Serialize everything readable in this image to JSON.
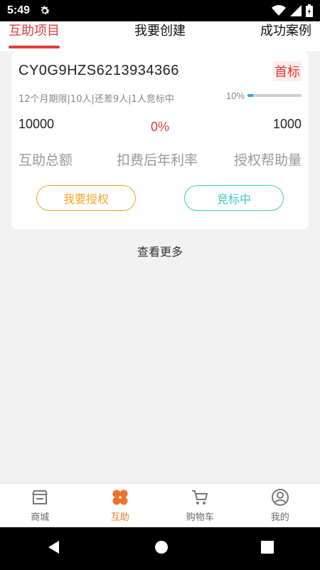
{
  "status": {
    "time": "5:49"
  },
  "tabs": [
    {
      "label": "互助项目",
      "active": true
    },
    {
      "label": "我要创建",
      "active": false
    },
    {
      "label": "成功案例",
      "active": false
    }
  ],
  "project": {
    "code": "CY0G9HZS6213934366",
    "badge": "首标",
    "meta": "12个月期限|10人|还差9人|1人竞标中",
    "progress_label": "10%",
    "progress_value": 0.1,
    "total_value": "10000",
    "rate_value": "0%",
    "auth_value": "1000",
    "total_label": "互助总额",
    "rate_label": "扣费后年利率",
    "auth_label": "授权帮助量",
    "authorize_button": "我要授权",
    "bidding_button": "竞标中"
  },
  "more_label": "查看更多",
  "bottom_nav": [
    {
      "label": "商城",
      "icon": "shop-icon",
      "active": false
    },
    {
      "label": "互助",
      "icon": "clover-icon",
      "active": true
    },
    {
      "label": "购物车",
      "icon": "cart-icon",
      "active": false
    },
    {
      "label": "我的",
      "icon": "user-icon",
      "active": false
    }
  ],
  "colors": {
    "accent_red": "#e23b3b",
    "accent_orange": "#f5a623",
    "accent_teal": "#3fc9c0",
    "nav_active": "#f07030"
  }
}
